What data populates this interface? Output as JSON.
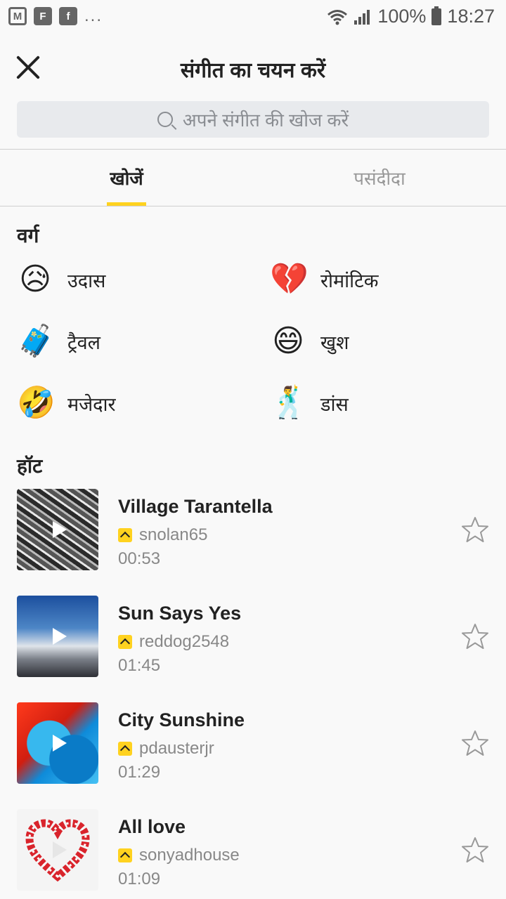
{
  "status_bar": {
    "left_icons": [
      "gmail-icon",
      "flipboard-icon",
      "facebook-icon"
    ],
    "overflow": "...",
    "battery": "100%",
    "time": "18:27"
  },
  "header": {
    "title": "संगीत का चयन करें",
    "close_icon": "close-icon"
  },
  "search": {
    "placeholder": "अपने संगीत की खोज करें"
  },
  "tabs": [
    {
      "label": "खोजें",
      "active": true
    },
    {
      "label": "पसंदीदा",
      "active": false
    }
  ],
  "categories": {
    "heading": "वर्ग",
    "items": [
      {
        "emoji": "😥",
        "label": "उदास"
      },
      {
        "emoji": "💔",
        "label": "रोमांटिक"
      },
      {
        "emoji": "🧳",
        "label": "ट्रैवल"
      },
      {
        "emoji": "😄",
        "label": "खुश"
      },
      {
        "emoji": "🤣",
        "label": "मजेदार"
      },
      {
        "emoji": "🕺",
        "label": "डांस"
      }
    ]
  },
  "hot": {
    "heading": "हॉट",
    "tracks": [
      {
        "title": "Village Tarantella",
        "user": "snolan65",
        "duration": "00:53"
      },
      {
        "title": "Sun Says Yes",
        "user": "reddog2548",
        "duration": "01:45"
      },
      {
        "title": "City Sunshine",
        "user": "pdausterjr",
        "duration": "01:29"
      },
      {
        "title": "All love",
        "user": "sonyadhouse",
        "duration": "01:09"
      }
    ]
  },
  "colors": {
    "accent": "#ffd21f",
    "text": "#222222",
    "muted": "#888888",
    "background": "#f9f9f9"
  }
}
